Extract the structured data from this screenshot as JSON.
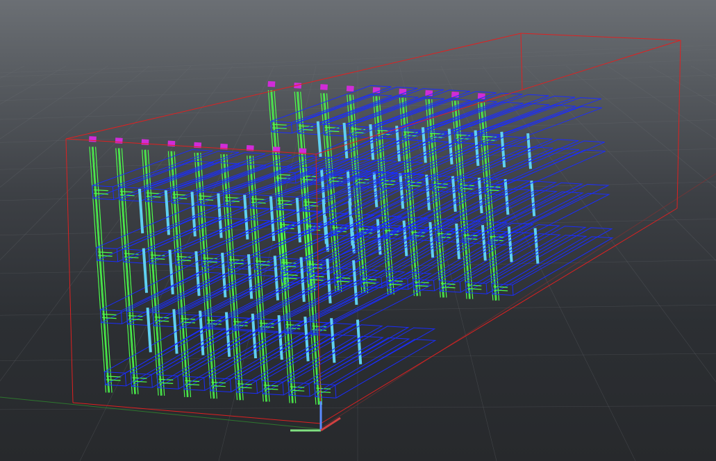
{
  "viewport": {
    "background_top": "#6b6f74",
    "background_bottom": "#27292c"
  },
  "colors": {
    "grid": "#6f7378",
    "bounding_box": "#e02020",
    "frame": "#4cff4c",
    "tray": "#1a2cff",
    "post": "#5fd0f0",
    "cap": "#d02cd8",
    "axis_x": "#d04040",
    "axis_y": "#80e080",
    "axis_z": "#5a8cff"
  },
  "scene": {
    "object_type": "shelf-rack-array-wireframe",
    "rows": 2,
    "columns": 9,
    "levels": 4,
    "display_mode": "wireframe"
  },
  "icons": {
    "axis_gizmo": "axis-gizmo-icon"
  }
}
